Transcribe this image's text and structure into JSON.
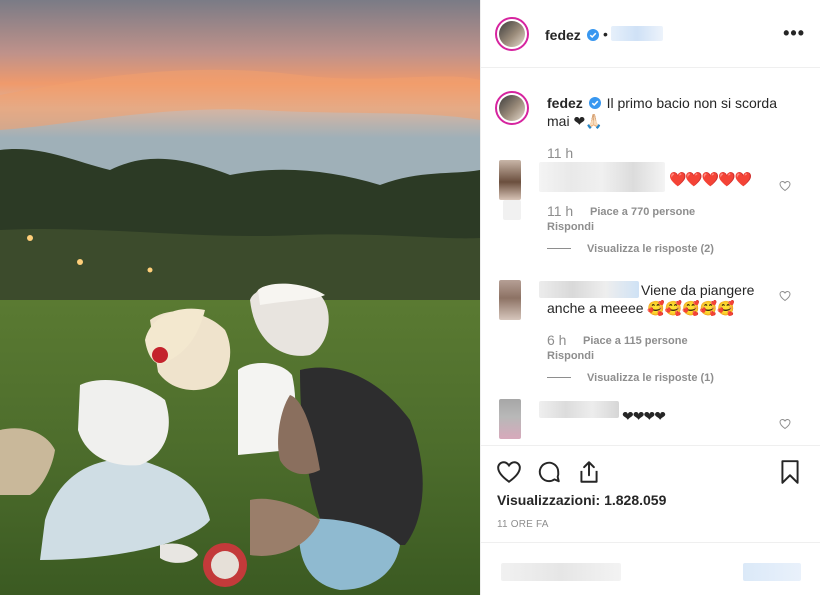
{
  "post": {
    "username": "fedez",
    "header_separator": "•",
    "caption_username": "fedez",
    "caption_text": "Il primo bacio non si scorda mai ❤🙏🏻",
    "caption_time": "11 h"
  },
  "comments": [
    {
      "text": "❤️❤️❤️❤️❤️",
      "time": "11 h",
      "likes": "Piace a 770 persone",
      "reply": "Rispondi",
      "view_replies": "Visualizza le risposte (2)"
    },
    {
      "text": "Viene da piangere anche a meeee 🥰🥰🥰🥰🥰",
      "time": "6 h",
      "likes": "Piace a 115 persone",
      "reply": "Rispondi",
      "view_replies": "Visualizza le risposte (1)"
    },
    {
      "text": "❤❤❤❤"
    }
  ],
  "footer": {
    "views_label": "Visualizzazioni: 1.828.059",
    "time_ago": "11 ORE FA"
  },
  "icons": {
    "more": "•••",
    "like": "heart-icon",
    "comment": "comment-icon",
    "share": "share-icon",
    "save": "bookmark-icon"
  },
  "colors": {
    "verified": "#3897f0",
    "text": "#262626",
    "secondary": "#8e8e8e"
  }
}
